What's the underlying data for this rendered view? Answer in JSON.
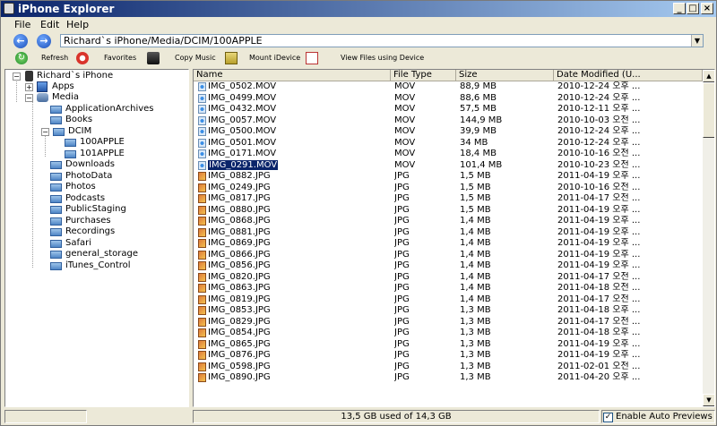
{
  "window": {
    "title": "iPhone Explorer",
    "controls": [
      "_",
      "□",
      "×"
    ]
  },
  "menu": [
    "File",
    "Edit",
    "Help"
  ],
  "nav": {
    "path": "Richard`s iPhone/Media/DCIM/100APPLE"
  },
  "toolbar": {
    "refresh": "Refresh",
    "favorites": "Favorites",
    "copy_music": "Copy Music",
    "mount": "Mount iDevice",
    "view_files": "View Files using Device"
  },
  "tree": {
    "root": "Richard`s iPhone",
    "apps": "Apps",
    "media": "Media",
    "media_children": [
      "ApplicationArchives",
      "Books",
      "DCIM",
      "Downloads",
      "PhotoData",
      "Photos",
      "Podcasts",
      "PublicStaging",
      "Purchases",
      "Recordings",
      "Safari",
      "general_storage",
      "iTunes_Control"
    ],
    "dcim_children": [
      "100APPLE",
      "101APPLE"
    ]
  },
  "columns": {
    "name": "Name",
    "type": "File Type",
    "size": "Size",
    "date": "Date Modified (U..."
  },
  "files": [
    {
      "name": "IMG_0502.MOV",
      "type": "MOV",
      "size": "88,9 MB",
      "date": "2010-12-24 오후 ..."
    },
    {
      "name": "IMG_0499.MOV",
      "type": "MOV",
      "size": "88,6 MB",
      "date": "2010-12-24 오후 ..."
    },
    {
      "name": "IMG_0432.MOV",
      "type": "MOV",
      "size": "57,5 MB",
      "date": "2010-12-11 오후 ..."
    },
    {
      "name": "IMG_0057.MOV",
      "type": "MOV",
      "size": "144,9 MB",
      "date": "2010-10-03 오전 ..."
    },
    {
      "name": "IMG_0500.MOV",
      "type": "MOV",
      "size": "39,9 MB",
      "date": "2010-12-24 오후 ..."
    },
    {
      "name": "IMG_0501.MOV",
      "type": "MOV",
      "size": "34 MB",
      "date": "2010-12-24 오후 ..."
    },
    {
      "name": "IMG_0171.MOV",
      "type": "MOV",
      "size": "18,4 MB",
      "date": "2010-10-16 오전 ..."
    },
    {
      "name": "IMG_0291.MOV",
      "type": "MOV",
      "size": "101,4 MB",
      "date": "2010-10-23 오전 ..."
    },
    {
      "name": "IMG_0882.JPG",
      "type": "JPG",
      "size": "1,5 MB",
      "date": "2011-04-19 오후 ..."
    },
    {
      "name": "IMG_0249.JPG",
      "type": "JPG",
      "size": "1,5 MB",
      "date": "2010-10-16 오전 ..."
    },
    {
      "name": "IMG_0817.JPG",
      "type": "JPG",
      "size": "1,5 MB",
      "date": "2011-04-17 오전 ..."
    },
    {
      "name": "IMG_0880.JPG",
      "type": "JPG",
      "size": "1,5 MB",
      "date": "2011-04-19 오후 ..."
    },
    {
      "name": "IMG_0868.JPG",
      "type": "JPG",
      "size": "1,4 MB",
      "date": "2011-04-19 오후 ..."
    },
    {
      "name": "IMG_0881.JPG",
      "type": "JPG",
      "size": "1,4 MB",
      "date": "2011-04-19 오후 ..."
    },
    {
      "name": "IMG_0869.JPG",
      "type": "JPG",
      "size": "1,4 MB",
      "date": "2011-04-19 오후 ..."
    },
    {
      "name": "IMG_0866.JPG",
      "type": "JPG",
      "size": "1,4 MB",
      "date": "2011-04-19 오후 ..."
    },
    {
      "name": "IMG_0856.JPG",
      "type": "JPG",
      "size": "1,4 MB",
      "date": "2011-04-19 오후 ..."
    },
    {
      "name": "IMG_0820.JPG",
      "type": "JPG",
      "size": "1,4 MB",
      "date": "2011-04-17 오전 ..."
    },
    {
      "name": "IMG_0863.JPG",
      "type": "JPG",
      "size": "1,4 MB",
      "date": "2011-04-18 오전 ..."
    },
    {
      "name": "IMG_0819.JPG",
      "type": "JPG",
      "size": "1,4 MB",
      "date": "2011-04-17 오전 ..."
    },
    {
      "name": "IMG_0853.JPG",
      "type": "JPG",
      "size": "1,3 MB",
      "date": "2011-04-18 오후 ..."
    },
    {
      "name": "IMG_0829.JPG",
      "type": "JPG",
      "size": "1,3 MB",
      "date": "2011-04-17 오전 ..."
    },
    {
      "name": "IMG_0854.JPG",
      "type": "JPG",
      "size": "1,3 MB",
      "date": "2011-04-18 오후 ..."
    },
    {
      "name": "IMG_0865.JPG",
      "type": "JPG",
      "size": "1,3 MB",
      "date": "2011-04-19 오후 ..."
    },
    {
      "name": "IMG_0876.JPG",
      "type": "JPG",
      "size": "1,3 MB",
      "date": "2011-04-19 오후 ..."
    },
    {
      "name": "IMG_0598.JPG",
      "type": "JPG",
      "size": "1,3 MB",
      "date": "2011-02-01 오전 ..."
    },
    {
      "name": "IMG_0890.JPG",
      "type": "JPG",
      "size": "1,3 MB",
      "date": "2011-04-20 오후 ..."
    }
  ],
  "selected_file": "IMG_0291.MOV",
  "status": {
    "usage": "13,5 GB used of 14,3 GB",
    "auto_preview": "Enable Auto Previews",
    "auto_preview_checked": true
  },
  "colors": {
    "title_start": "#0a246a",
    "title_end": "#a6caf0",
    "selection": "#0a246a"
  }
}
